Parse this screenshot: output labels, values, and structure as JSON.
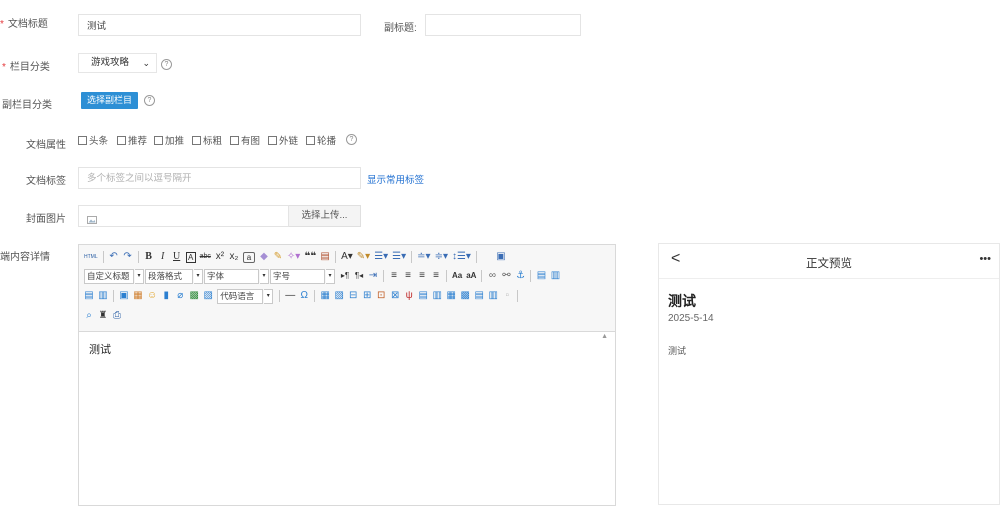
{
  "form": {
    "title_label": "文档标题",
    "title_value": "测试",
    "subtitle_label": "副标题:",
    "subtitle_value": "",
    "category_label": "栏目分类",
    "category_value": "游戏攻略",
    "subcategory_label": "副栏目分类",
    "subcategory_button": "选择副栏目",
    "attributes_label": "文档属性",
    "attributes": [
      "头条",
      "推荐",
      "加推",
      "标粗",
      "有图",
      "外链",
      "轮播"
    ],
    "tags_label": "文档标签",
    "tags_placeholder": "多个标签之间以逗号隔开",
    "tags_link": "显示常用标签",
    "cover_label": "封面图片",
    "cover_button": "选择上传...",
    "content_label": "端内容详情",
    "required_mark": "*",
    "help_mark": "?"
  },
  "editor": {
    "selects": [
      {
        "name": "custom-title-select",
        "label": "自定义标题"
      },
      {
        "name": "paragraph-format-select",
        "label": "段落格式"
      },
      {
        "name": "font-family-select",
        "label": "字体"
      },
      {
        "name": "font-size-select",
        "label": "字号"
      },
      {
        "name": "code-language-select",
        "label": "代码语言"
      }
    ],
    "content": "测试"
  },
  "preview": {
    "back": "<",
    "header_title": "正文预览",
    "more": "•••",
    "title": "测试",
    "date": "2025-5-14",
    "body": "测试"
  }
}
